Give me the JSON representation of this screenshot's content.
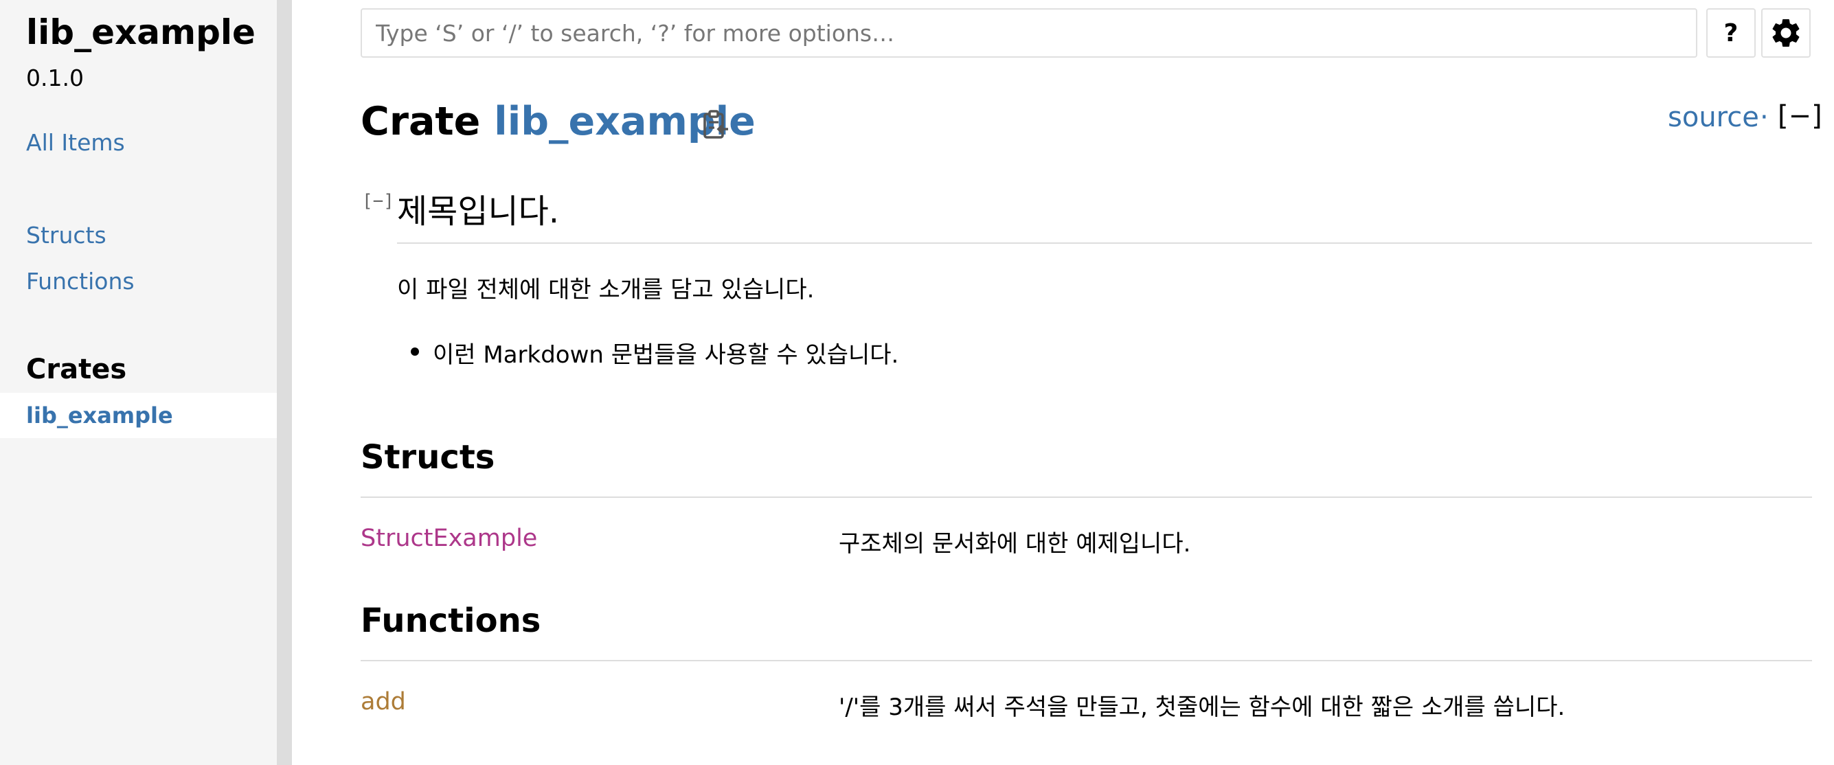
{
  "sidebar": {
    "crate_title": "lib_example",
    "version": "0.1.0",
    "all_items": "All Items",
    "structs": "Structs",
    "functions": "Functions",
    "crates_heading": "Crates",
    "current_crate": "lib_example"
  },
  "search": {
    "placeholder": "Type ‘S’ or ‘/’ to search, ‘?’ for more options…",
    "value": ""
  },
  "toolbar": {
    "help_label": "?",
    "help_icon": "question-mark-icon",
    "settings_icon": "gear-icon"
  },
  "main": {
    "title_prefix": "Crate",
    "crate_name": "lib_example",
    "copy_icon": "clipboard-icon",
    "source_label": "source",
    "source_sep": "·",
    "collapse_all_label": "[−]",
    "collapse_toggle": "[−]",
    "doc_heading": "제목입니다.",
    "doc_paragraph": "이 파일 전체에 대한 소개를 담고 있습니다.",
    "bullets": [
      "이런 Markdown 문법들을 사용할 수 있습니다."
    ]
  },
  "structs_section": {
    "heading": "Structs",
    "items": [
      {
        "name": "StructExample",
        "desc": "구조체의 문서화에 대한 예제입니다."
      }
    ]
  },
  "functions_section": {
    "heading": "Functions",
    "items": [
      {
        "name": "add",
        "desc": "'/'를 3개를 써서 주석을 만들고, 첫줄에는 함수에 대한 짧은 소개를 씁니다."
      }
    ]
  },
  "colors": {
    "link": "#3873ad",
    "struct": "#ad378a",
    "function": "#ad7c37",
    "sidebar_bg": "#f5f5f5"
  }
}
